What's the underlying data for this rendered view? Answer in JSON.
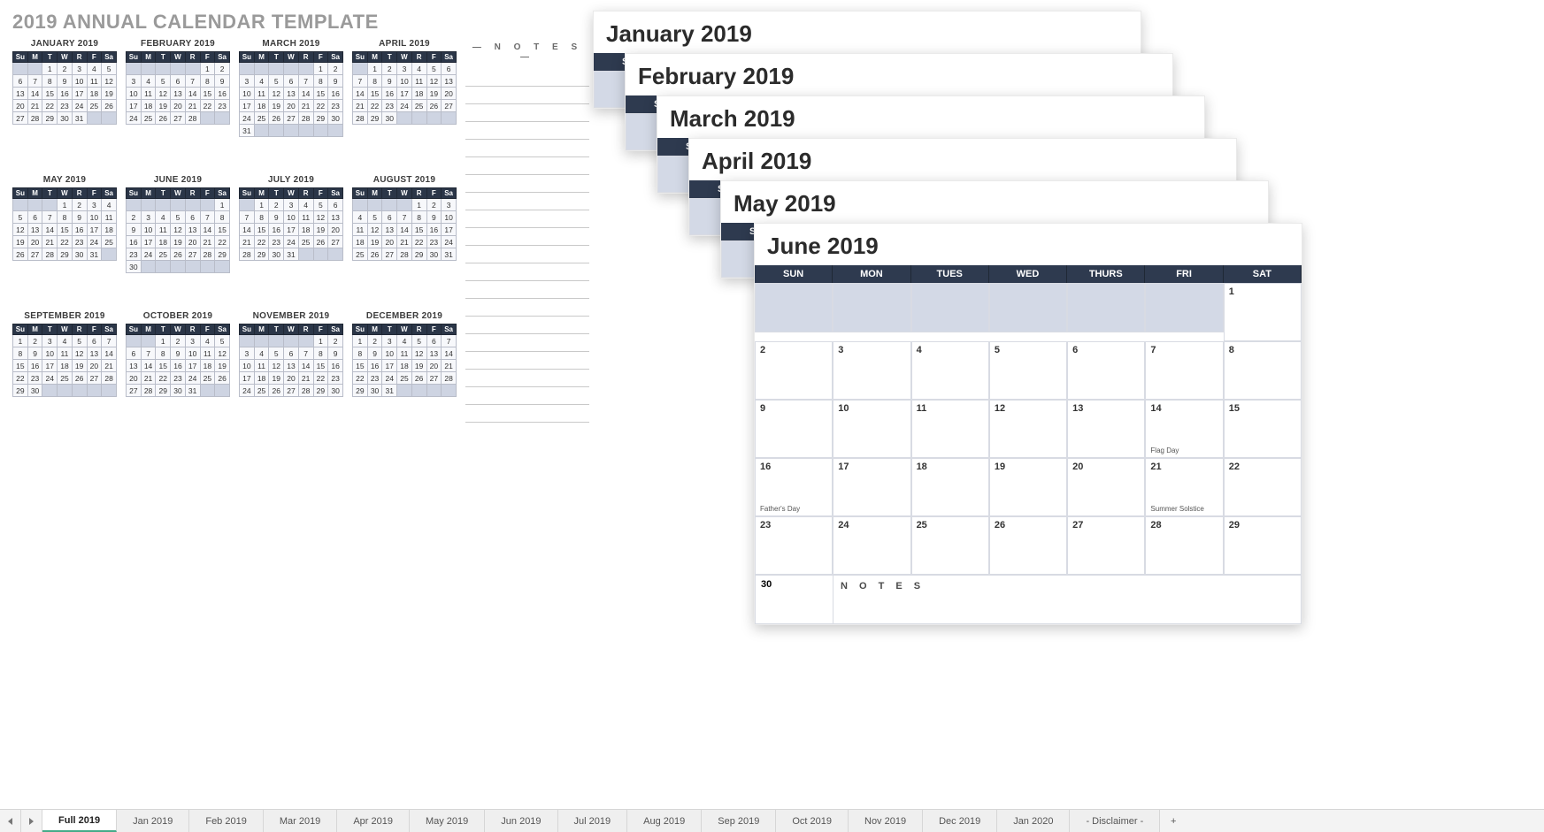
{
  "title": "2019 ANNUAL CALENDAR TEMPLATE",
  "dayShort": [
    "Su",
    "M",
    "T",
    "W",
    "R",
    "F",
    "Sa"
  ],
  "dayLong": [
    "SUN",
    "MON",
    "TUES",
    "WED",
    "THURS",
    "FRI",
    "SAT"
  ],
  "notesLabel": "N O T E S",
  "months": [
    {
      "name": "JANUARY 2019",
      "start": 2,
      "days": 31
    },
    {
      "name": "FEBRUARY 2019",
      "start": 5,
      "days": 28
    },
    {
      "name": "MARCH 2019",
      "start": 5,
      "days": 31
    },
    {
      "name": "APRIL 2019",
      "start": 1,
      "days": 30
    },
    {
      "name": "MAY 2019",
      "start": 3,
      "days": 31
    },
    {
      "name": "JUNE 2019",
      "start": 6,
      "days": 30
    },
    {
      "name": "JULY 2019",
      "start": 1,
      "days": 31
    },
    {
      "name": "AUGUST 2019",
      "start": 4,
      "days": 31
    },
    {
      "name": "SEPTEMBER 2019",
      "start": 0,
      "days": 30
    },
    {
      "name": "OCTOBER 2019",
      "start": 2,
      "days": 31
    },
    {
      "name": "NOVEMBER 2019",
      "start": 5,
      "days": 30
    },
    {
      "name": "DECEMBER 2019",
      "start": 0,
      "days": 31
    }
  ],
  "stack": [
    {
      "title": "January 2019"
    },
    {
      "title": "February 2019"
    },
    {
      "title": "March 2019"
    },
    {
      "title": "April 2019"
    },
    {
      "title": "May 2019"
    }
  ],
  "june": {
    "title": "June 2019",
    "start": 6,
    "days": 30,
    "events": {
      "14": "Flag Day",
      "16": "Father's Day",
      "21": "Summer Solstice"
    },
    "lastCell": "30",
    "notes": "NOTES"
  },
  "tabs": {
    "active": "Full 2019",
    "list": [
      "Full 2019",
      "Jan 2019",
      "Feb 2019",
      "Mar 2019",
      "Apr 2019",
      "May 2019",
      "Jun 2019",
      "Jul 2019",
      "Aug 2019",
      "Sep 2019",
      "Oct 2019",
      "Nov 2019",
      "Dec 2019",
      "Jan 2020",
      "- Disclaimer -"
    ]
  }
}
